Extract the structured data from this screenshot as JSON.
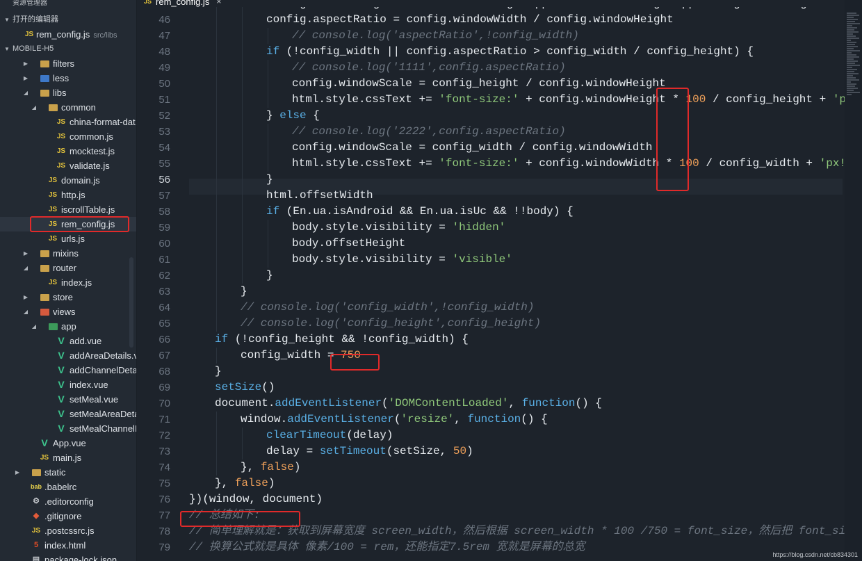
{
  "sidebar": {
    "title": "资源管理器",
    "open_editors_label": "打开的编辑器",
    "open_file": {
      "name": "rem_config.js",
      "path": "src/libs"
    },
    "project_label": "MOBILE-H5",
    "tree": [
      {
        "label": "filters",
        "icon": "folder",
        "depth": 1,
        "twisty": "collapsed"
      },
      {
        "label": "less",
        "icon": "folder-blue",
        "depth": 1,
        "twisty": "collapsed"
      },
      {
        "label": "libs",
        "icon": "folder",
        "depth": 1,
        "twisty": "expanded"
      },
      {
        "label": "common",
        "icon": "folder",
        "depth": 2,
        "twisty": "expanded"
      },
      {
        "label": "china-format-dat...",
        "icon": "js",
        "depth": 3
      },
      {
        "label": "common.js",
        "icon": "js",
        "depth": 3
      },
      {
        "label": "mocktest.js",
        "icon": "js",
        "depth": 3
      },
      {
        "label": "validate.js",
        "icon": "js",
        "depth": 3
      },
      {
        "label": "domain.js",
        "icon": "js",
        "depth": 2
      },
      {
        "label": "http.js",
        "icon": "js",
        "depth": 2
      },
      {
        "label": "iscrollTable.js",
        "icon": "js",
        "depth": 2
      },
      {
        "label": "rem_config.js",
        "icon": "js",
        "depth": 2,
        "active": true
      },
      {
        "label": "urls.js",
        "icon": "js",
        "depth": 2
      },
      {
        "label": "mixins",
        "icon": "folder",
        "depth": 1,
        "twisty": "collapsed"
      },
      {
        "label": "router",
        "icon": "folder",
        "depth": 1,
        "twisty": "expanded"
      },
      {
        "label": "index.js",
        "icon": "js",
        "depth": 2
      },
      {
        "label": "store",
        "icon": "folder",
        "depth": 1,
        "twisty": "collapsed"
      },
      {
        "label": "views",
        "icon": "folder-red",
        "depth": 1,
        "twisty": "expanded"
      },
      {
        "label": "app",
        "icon": "folder-green",
        "depth": 2,
        "twisty": "expanded"
      },
      {
        "label": "add.vue",
        "icon": "vue",
        "depth": 3
      },
      {
        "label": "addAreaDetails.v...",
        "icon": "vue",
        "depth": 3
      },
      {
        "label": "addChannelDetai...",
        "icon": "vue",
        "depth": 3
      },
      {
        "label": "index.vue",
        "icon": "vue",
        "depth": 3
      },
      {
        "label": "setMeal.vue",
        "icon": "vue",
        "depth": 3
      },
      {
        "label": "setMealAreaDeta...",
        "icon": "vue",
        "depth": 3
      },
      {
        "label": "setMealChannelD...",
        "icon": "vue",
        "depth": 3
      },
      {
        "label": "App.vue",
        "icon": "vue",
        "depth": 1
      },
      {
        "label": "main.js",
        "icon": "js",
        "depth": 1
      },
      {
        "label": "static",
        "icon": "folder",
        "depth": 0,
        "twisty": "collapsed"
      },
      {
        "label": ".babelrc",
        "icon": "babel",
        "depth": 0
      },
      {
        "label": ".editorconfig",
        "icon": "cfg",
        "depth": 0
      },
      {
        "label": ".gitignore",
        "icon": "git",
        "depth": 0
      },
      {
        "label": ".postcssrc.js",
        "icon": "js",
        "depth": 0
      },
      {
        "label": "index.html",
        "icon": "html5",
        "depth": 0
      },
      {
        "label": "package-lock.json",
        "icon": "file",
        "depth": 0
      }
    ]
  },
  "tab": {
    "icon_text": "JS",
    "label": "rem_config.js",
    "close": "×"
  },
  "editor": {
    "current_line": 56,
    "lines": [
      {
        "n": "45",
        "indent": 3,
        "tokens": [
          [
            "config.windowHeight = html.clientHeight || window.innerHeight || html.getBoundingClientRect",
            "obj"
          ]
        ]
      },
      {
        "n": "46",
        "indent": 3,
        "tokens": [
          [
            "config",
            "obj"
          ],
          [
            ".",
            "op"
          ],
          [
            "aspectRatio",
            "prop"
          ],
          [
            " = ",
            "op"
          ],
          [
            "config",
            "obj"
          ],
          [
            ".",
            "op"
          ],
          [
            "windowWidth",
            "prop"
          ],
          [
            " / ",
            "op"
          ],
          [
            "config",
            "obj"
          ],
          [
            ".",
            "op"
          ],
          [
            "windowHeight",
            "prop"
          ]
        ]
      },
      {
        "n": "47",
        "indent": 4,
        "tokens": [
          [
            "// console.log('aspectRatio',!config_width)",
            "com"
          ]
        ]
      },
      {
        "n": "48",
        "indent": 3,
        "tokens": [
          [
            "if",
            "kw"
          ],
          [
            " (",
            "op"
          ],
          [
            "!",
            "op"
          ],
          [
            "config_width",
            "obj"
          ],
          [
            " || ",
            "op"
          ],
          [
            "config",
            "obj"
          ],
          [
            ".",
            "op"
          ],
          [
            "aspectRatio",
            "prop"
          ],
          [
            " > ",
            "op"
          ],
          [
            "config_width",
            "obj"
          ],
          [
            " / ",
            "op"
          ],
          [
            "config_height",
            "obj"
          ],
          [
            ") {",
            "op"
          ]
        ]
      },
      {
        "n": "49",
        "indent": 4,
        "tokens": [
          [
            "// console.log('1111',config.aspectRatio)",
            "com"
          ]
        ]
      },
      {
        "n": "50",
        "indent": 4,
        "tokens": [
          [
            "config",
            "obj"
          ],
          [
            ".",
            "op"
          ],
          [
            "windowScale",
            "prop"
          ],
          [
            " = ",
            "op"
          ],
          [
            "config_height",
            "obj"
          ],
          [
            " / ",
            "op"
          ],
          [
            "config",
            "obj"
          ],
          [
            ".",
            "op"
          ],
          [
            "windowHeight",
            "prop"
          ]
        ]
      },
      {
        "n": "51",
        "indent": 4,
        "tokens": [
          [
            "html",
            "obj"
          ],
          [
            ".",
            "op"
          ],
          [
            "style",
            "prop"
          ],
          [
            ".",
            "op"
          ],
          [
            "cssText",
            "prop"
          ],
          [
            " += ",
            "op"
          ],
          [
            "'font-size:'",
            "str"
          ],
          [
            " + ",
            "op"
          ],
          [
            "config",
            "obj"
          ],
          [
            ".",
            "op"
          ],
          [
            "windowHeight",
            "prop"
          ],
          [
            " * ",
            "op"
          ],
          [
            "100",
            "num"
          ],
          [
            " / ",
            "op"
          ],
          [
            "config_height",
            "obj"
          ],
          [
            " + ",
            "op"
          ],
          [
            "'px!im",
            "str"
          ]
        ]
      },
      {
        "n": "52",
        "indent": 3,
        "tokens": [
          [
            "} ",
            "op"
          ],
          [
            "else",
            "kw"
          ],
          [
            " {",
            "op"
          ]
        ]
      },
      {
        "n": "53",
        "indent": 4,
        "tokens": [
          [
            "// console.log('2222',config.aspectRatio)",
            "com"
          ]
        ]
      },
      {
        "n": "54",
        "indent": 4,
        "tokens": [
          [
            "config",
            "obj"
          ],
          [
            ".",
            "op"
          ],
          [
            "windowScale",
            "prop"
          ],
          [
            " = ",
            "op"
          ],
          [
            "config_width",
            "obj"
          ],
          [
            " / ",
            "op"
          ],
          [
            "config",
            "obj"
          ],
          [
            ".",
            "op"
          ],
          [
            "windowWidth",
            "prop"
          ]
        ]
      },
      {
        "n": "55",
        "indent": 4,
        "tokens": [
          [
            "html",
            "obj"
          ],
          [
            ".",
            "op"
          ],
          [
            "style",
            "prop"
          ],
          [
            ".",
            "op"
          ],
          [
            "cssText",
            "prop"
          ],
          [
            " += ",
            "op"
          ],
          [
            "'font-size:'",
            "str"
          ],
          [
            " + ",
            "op"
          ],
          [
            "config",
            "obj"
          ],
          [
            ".",
            "op"
          ],
          [
            "windowWidth",
            "prop"
          ],
          [
            " * ",
            "op"
          ],
          [
            "100",
            "num"
          ],
          [
            " / ",
            "op"
          ],
          [
            "config_width",
            "obj"
          ],
          [
            " + ",
            "op"
          ],
          [
            "'px!impo",
            "str"
          ]
        ]
      },
      {
        "n": "56",
        "indent": 3,
        "tokens": [
          [
            "}",
            "op"
          ]
        ]
      },
      {
        "n": "57",
        "indent": 3,
        "tokens": [
          [
            "html",
            "obj"
          ],
          [
            ".",
            "op"
          ],
          [
            "offsetWidth",
            "prop"
          ]
        ]
      },
      {
        "n": "58",
        "indent": 3,
        "tokens": [
          [
            "if",
            "kw"
          ],
          [
            " (",
            "op"
          ],
          [
            "En",
            "obj"
          ],
          [
            ".",
            "op"
          ],
          [
            "ua",
            "prop"
          ],
          [
            ".",
            "op"
          ],
          [
            "isAndroid",
            "prop"
          ],
          [
            " && ",
            "op"
          ],
          [
            "En",
            "obj"
          ],
          [
            ".",
            "op"
          ],
          [
            "ua",
            "prop"
          ],
          [
            ".",
            "op"
          ],
          [
            "isUc",
            "prop"
          ],
          [
            " && ",
            "op"
          ],
          [
            "!!",
            "op"
          ],
          [
            "body",
            "obj"
          ],
          [
            ") {",
            "op"
          ]
        ]
      },
      {
        "n": "59",
        "indent": 4,
        "tokens": [
          [
            "body",
            "obj"
          ],
          [
            ".",
            "op"
          ],
          [
            "style",
            "prop"
          ],
          [
            ".",
            "op"
          ],
          [
            "visibility",
            "prop"
          ],
          [
            " = ",
            "op"
          ],
          [
            "'hidden'",
            "str"
          ]
        ]
      },
      {
        "n": "60",
        "indent": 4,
        "tokens": [
          [
            "body",
            "obj"
          ],
          [
            ".",
            "op"
          ],
          [
            "offsetHeight",
            "prop"
          ]
        ]
      },
      {
        "n": "61",
        "indent": 4,
        "tokens": [
          [
            "body",
            "obj"
          ],
          [
            ".",
            "op"
          ],
          [
            "style",
            "prop"
          ],
          [
            ".",
            "op"
          ],
          [
            "visibility",
            "prop"
          ],
          [
            " = ",
            "op"
          ],
          [
            "'visible'",
            "str"
          ]
        ]
      },
      {
        "n": "62",
        "indent": 3,
        "tokens": [
          [
            "}",
            "op"
          ]
        ]
      },
      {
        "n": "63",
        "indent": 2,
        "tokens": [
          [
            "}",
            "op"
          ]
        ]
      },
      {
        "n": "64",
        "indent": 2,
        "tokens": [
          [
            "// console.log('config_width',!config_width)",
            "com"
          ]
        ]
      },
      {
        "n": "65",
        "indent": 2,
        "tokens": [
          [
            "// console.log('config_height',config_height)",
            "com"
          ]
        ]
      },
      {
        "n": "66",
        "indent": 1,
        "tokens": [
          [
            "if",
            "kw"
          ],
          [
            " (",
            "op"
          ],
          [
            "!",
            "op"
          ],
          [
            "config_height",
            "obj"
          ],
          [
            " && ",
            "op"
          ],
          [
            "!",
            "op"
          ],
          [
            "config_width",
            "obj"
          ],
          [
            ") {",
            "op"
          ]
        ]
      },
      {
        "n": "67",
        "indent": 2,
        "tokens": [
          [
            "config_width",
            "obj"
          ],
          [
            " = ",
            "op"
          ],
          [
            "750",
            "num"
          ]
        ]
      },
      {
        "n": "68",
        "indent": 1,
        "tokens": [
          [
            "}",
            "op"
          ]
        ]
      },
      {
        "n": "69",
        "indent": 1,
        "tokens": [
          [
            "setSize",
            "fn"
          ],
          [
            "()",
            "op"
          ]
        ]
      },
      {
        "n": "70",
        "indent": 1,
        "tokens": [
          [
            "document",
            "obj"
          ],
          [
            ".",
            "op"
          ],
          [
            "addEventListener",
            "fn"
          ],
          [
            "(",
            "op"
          ],
          [
            "'DOMContentLoaded'",
            "str"
          ],
          [
            ", ",
            "op"
          ],
          [
            "function",
            "kw"
          ],
          [
            "() {",
            "op"
          ]
        ]
      },
      {
        "n": "71",
        "indent": 2,
        "tokens": [
          [
            "window",
            "obj"
          ],
          [
            ".",
            "op"
          ],
          [
            "addEventListener",
            "fn"
          ],
          [
            "(",
            "op"
          ],
          [
            "'resize'",
            "str"
          ],
          [
            ", ",
            "op"
          ],
          [
            "function",
            "kw"
          ],
          [
            "() {",
            "op"
          ]
        ]
      },
      {
        "n": "72",
        "indent": 3,
        "tokens": [
          [
            "clearTimeout",
            "fn"
          ],
          [
            "(",
            "op"
          ],
          [
            "delay",
            "obj"
          ],
          [
            ")",
            "op"
          ]
        ]
      },
      {
        "n": "73",
        "indent": 3,
        "tokens": [
          [
            "delay",
            "obj"
          ],
          [
            " = ",
            "op"
          ],
          [
            "setTimeout",
            "fn"
          ],
          [
            "(",
            "op"
          ],
          [
            "setSize",
            "obj"
          ],
          [
            ", ",
            "op"
          ],
          [
            "50",
            "num"
          ],
          [
            ")",
            "op"
          ]
        ]
      },
      {
        "n": "74",
        "indent": 2,
        "tokens": [
          [
            "}, ",
            "op"
          ],
          [
            "false",
            "lit"
          ],
          [
            ")",
            "op"
          ]
        ]
      },
      {
        "n": "75",
        "indent": 1,
        "tokens": [
          [
            "}, ",
            "op"
          ],
          [
            "false",
            "lit"
          ],
          [
            ")",
            "op"
          ]
        ]
      },
      {
        "n": "76",
        "indent": 0,
        "tokens": [
          [
            "})(",
            "op"
          ],
          [
            "window",
            "obj"
          ],
          [
            ", ",
            "op"
          ],
          [
            "document",
            "obj"
          ],
          [
            ")",
            "op"
          ]
        ]
      },
      {
        "n": "77",
        "indent": 0,
        "tokens": [
          [
            "// 总结如下:",
            "com"
          ]
        ]
      },
      {
        "n": "78",
        "indent": 0,
        "tokens": [
          [
            "// 简单理解就是：获取到屏幕宽度 screen_width，然后根据 screen_width * 100 /750 = font_size，然后把 font_size 设",
            "com"
          ]
        ]
      },
      {
        "n": "79",
        "indent": 0,
        "tokens": [
          [
            "// 换算公式就是具体 像素/100 = rem，还能指定7.5rem 宽就是屏幕的总宽",
            "com"
          ]
        ]
      }
    ]
  },
  "watermark": "https://blog.csdn.net/cb834301",
  "colors": {
    "annotation": "#e02a2a",
    "keyword": "#5ab0e6",
    "string": "#90c97b",
    "number": "#f0a15a",
    "comment": "#6d7681"
  }
}
